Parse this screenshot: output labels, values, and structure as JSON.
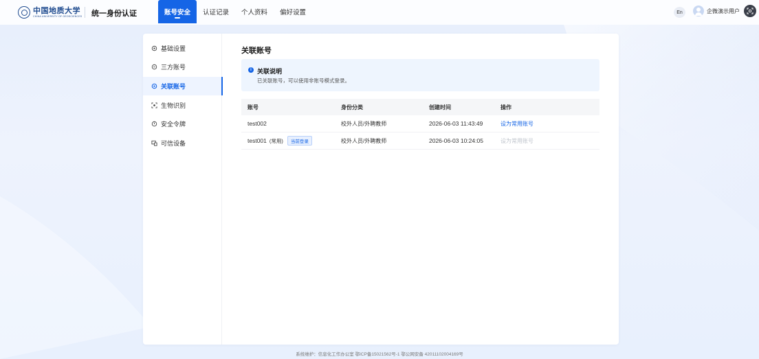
{
  "header": {
    "logo_cn": "中国地质大学",
    "logo_en": "CHINA UNIVERSITY OF GEOSCIENCES",
    "brand_title": "统一身份认证",
    "nav": [
      {
        "label": "账号安全",
        "active": true
      },
      {
        "label": "认证记录",
        "active": false
      },
      {
        "label": "个人资料",
        "active": false
      },
      {
        "label": "偏好设置",
        "active": false
      }
    ],
    "lang": "En",
    "user_name": "企微演示用户"
  },
  "sidebar": {
    "items": [
      {
        "label": "基础设置",
        "icon": "gear-icon",
        "active": false
      },
      {
        "label": "三方账号",
        "icon": "link-icon",
        "active": false
      },
      {
        "label": "关联账号",
        "icon": "gear-icon",
        "active": true
      },
      {
        "label": "生物识别",
        "icon": "face-scan-icon",
        "active": false
      },
      {
        "label": "安全令牌",
        "icon": "shield-icon",
        "active": false
      },
      {
        "label": "可信设备",
        "icon": "device-icon",
        "active": false
      }
    ]
  },
  "main": {
    "title": "关联账号",
    "notice": {
      "title": "关联说明",
      "text": "已关联账号，可以使用非账号模式登录。"
    },
    "table": {
      "columns": [
        "账号",
        "身份分类",
        "创建时间",
        "操作"
      ],
      "rows": [
        {
          "account": "test002",
          "tag": "",
          "badge": "",
          "category": "校外人员/外聘教师",
          "created": "2026-06-03 11:43:49",
          "action": "设为常用账号",
          "action_enabled": true
        },
        {
          "account": "test001",
          "tag": "(常用)",
          "badge": "当前登录",
          "category": "校外人员/外聘教师",
          "created": "2026-06-03 10:24:05",
          "action": "设为常用账号",
          "action_enabled": false
        }
      ]
    }
  },
  "footer": {
    "text": "系统维护：信息化工作办公室 鄂ICP备15021562号-1 鄂公网安备 42011102004169号"
  },
  "colors": {
    "primary": "#1565e6",
    "background": "#e9f0fd"
  }
}
